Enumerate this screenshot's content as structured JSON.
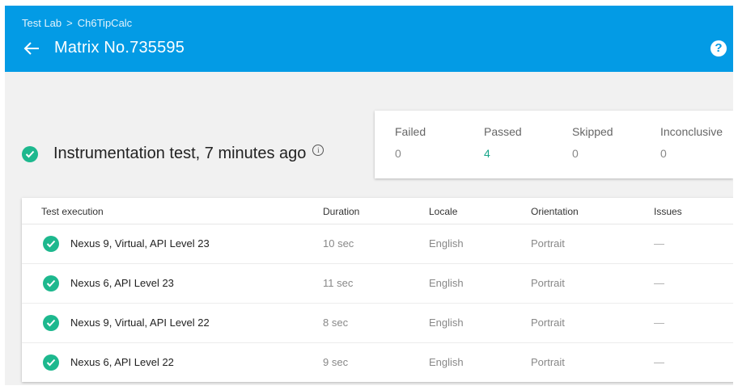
{
  "header": {
    "breadcrumb": [
      "Test Lab",
      "Ch6TipCalc"
    ],
    "separator": ">",
    "title": "Matrix No.735595",
    "help": "?"
  },
  "summary": {
    "text": "Instrumentation test, 7 minutes ago",
    "info": "i"
  },
  "stats": [
    {
      "label": "Failed",
      "value": "0"
    },
    {
      "label": "Passed",
      "value": "4"
    },
    {
      "label": "Skipped",
      "value": "0"
    },
    {
      "label": "Inconclusive",
      "value": "0"
    }
  ],
  "table": {
    "headers": [
      "Test execution",
      "Duration",
      "Locale",
      "Orientation",
      "Issues"
    ],
    "rows": [
      {
        "device": "Nexus 9, Virtual, API Level 23",
        "duration": "10 sec",
        "locale": "English",
        "orientation": "Portrait",
        "issues": "—"
      },
      {
        "device": "Nexus 6, API Level 23",
        "duration": "11 sec",
        "locale": "English",
        "orientation": "Portrait",
        "issues": "—"
      },
      {
        "device": "Nexus 9, Virtual, API Level 22",
        "duration": "8 sec",
        "locale": "English",
        "orientation": "Portrait",
        "issues": "—"
      },
      {
        "device": "Nexus 6, API Level 22",
        "duration": "9 sec",
        "locale": "English",
        "orientation": "Portrait",
        "issues": "—"
      }
    ]
  },
  "colors": {
    "header_bg": "#039be5",
    "success": "#1db88e",
    "passed_text": "#1aa68a"
  },
  "icons": {
    "back": "arrow-left-icon",
    "help": "help-circle-icon",
    "status": "check-circle-icon",
    "info": "info-icon"
  }
}
